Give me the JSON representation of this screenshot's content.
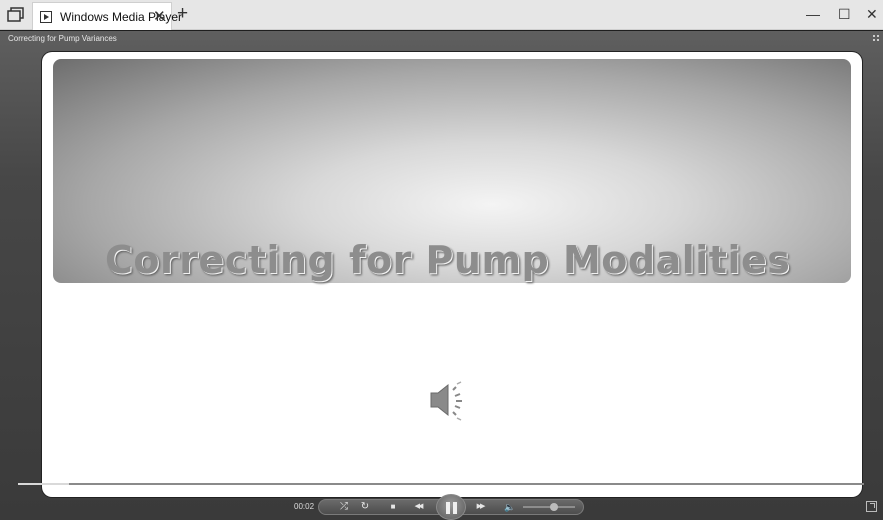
{
  "tab": {
    "title": "Windows Media Player",
    "close_glyph": "✕"
  },
  "newtab_glyph": "+",
  "window_controls": {
    "minimize": "—",
    "maximize": "☐",
    "close": "✕"
  },
  "player": {
    "now_playing": "Correcting for Pump Variances",
    "slide_title": "Correcting for Pump Modalities",
    "time": "00:02",
    "seek_progress": 0.06,
    "volume_level": 0.6
  },
  "icons": {
    "tab_manager": "tab-manager-icon",
    "app": "media-player-icon",
    "speaker": "speaker-icon"
  },
  "controls": {
    "shuffle": "⤮",
    "repeat": "↻",
    "stop": "■",
    "previous": "◀◀",
    "next": "▶▶",
    "mute": "🔈"
  }
}
